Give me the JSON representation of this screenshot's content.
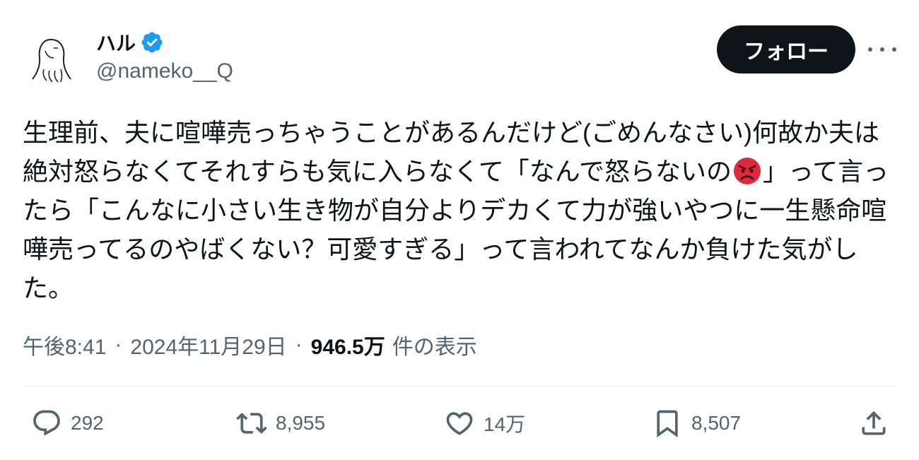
{
  "user": {
    "display_name": "ハル",
    "handle": "@nameko__Q",
    "verified": true,
    "verified_color": "#1d9bf0"
  },
  "follow_label": "フォロー",
  "tweet": {
    "text_before_emoji": "生理前、夫に喧嘩売っちゃうことがあるんだけど(ごめんなさい)何故か夫は絶対怒らなくてそれすらも気に入らなくて「なんで怒らないの",
    "emoji": "angry-face-emoji",
    "text_after_emoji": "」って言ったら「こんなに小さい生き物が自分よりデカくて力が強いやつに一生懸命喧嘩売ってるのやばくない？可愛すぎる」って言われてなんか負けた気がした。"
  },
  "meta": {
    "time": "午後8:41",
    "separator": "·",
    "date": "2024年11月29日",
    "views_count": "946.5万",
    "views_label": "件の表示"
  },
  "actions": {
    "reply_count": "292",
    "retweet_count": "8,955",
    "like_count": "14万",
    "bookmark_count": "8,507"
  },
  "icons": [
    "verified-badge-icon",
    "more-icon",
    "reply-icon",
    "retweet-icon",
    "like-icon",
    "bookmark-icon",
    "share-icon"
  ],
  "colors": {
    "text": "#0f1419",
    "secondary": "#536471",
    "follow_bg": "#0f1419",
    "emoji_red": "#e0283b"
  }
}
